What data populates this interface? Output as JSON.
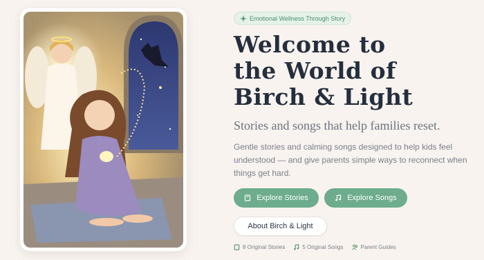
{
  "badge": {
    "icon": "sparkle-icon",
    "label": "Emotional Wellness Through Story"
  },
  "hero": {
    "title_lines": [
      "Welcome to",
      "the World of",
      "Birch & Light"
    ],
    "subtitle": "Stories and songs that help families reset.",
    "description": "Gentle stories and calming songs designed to help kids feel understood — and give parents simple ways to reconnect when things get hard."
  },
  "buttons": {
    "stories": {
      "label": "Explore Stories",
      "icon": "book-icon"
    },
    "songs": {
      "label": "Explore Songs",
      "icon": "music-note-icon"
    },
    "about": {
      "label": "About Birch & Light"
    }
  },
  "stats": [
    {
      "icon": "book-icon",
      "label": "8 Original Stories"
    },
    {
      "icon": "music-note-icon",
      "label": "5 Original Songs"
    },
    {
      "icon": "users-icon",
      "label": "Parent Guides"
    }
  ],
  "colors": {
    "accent": "#6dac8d",
    "badge_bg": "#e5f1e9",
    "page_bg": "#f8f3ef",
    "heading": "#252e3d"
  }
}
